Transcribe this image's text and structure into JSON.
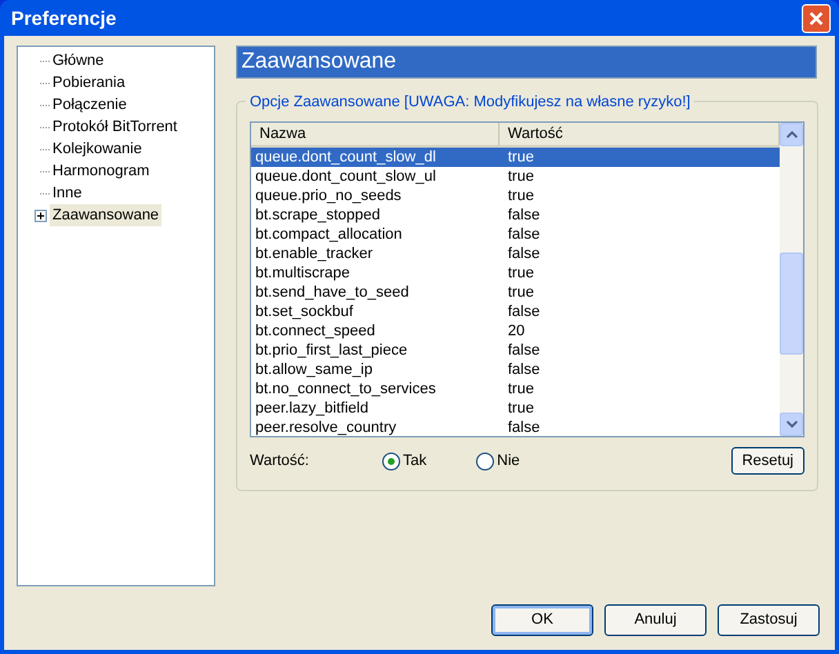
{
  "window": {
    "title": "Preferencje"
  },
  "sidebar": {
    "items": [
      {
        "label": "Główne",
        "kind": "leaf",
        "selected": false
      },
      {
        "label": "Pobierania",
        "kind": "leaf",
        "selected": false
      },
      {
        "label": "Połączenie",
        "kind": "leaf",
        "selected": false
      },
      {
        "label": "Protokół BitTorrent",
        "kind": "leaf",
        "selected": false
      },
      {
        "label": "Kolejkowanie",
        "kind": "leaf",
        "selected": false
      },
      {
        "label": "Harmonogram",
        "kind": "leaf",
        "selected": false
      },
      {
        "label": "Inne",
        "kind": "leaf",
        "selected": false
      },
      {
        "label": "Zaawansowane",
        "kind": "group",
        "expanded": false,
        "selected": true
      }
    ]
  },
  "page_title": "Zaawansowane",
  "group": {
    "legend": "Opcje Zaawansowane [UWAGA: Modyfikujesz na własne ryzyko!]",
    "table": {
      "columns": [
        "Nazwa",
        "Wartość"
      ],
      "rows": [
        {
          "name": "queue.dont_count_slow_dl",
          "value": "true",
          "selected": true
        },
        {
          "name": "queue.dont_count_slow_ul",
          "value": "true",
          "selected": false
        },
        {
          "name": "queue.prio_no_seeds",
          "value": "true",
          "selected": false
        },
        {
          "name": "bt.scrape_stopped",
          "value": "false",
          "selected": false
        },
        {
          "name": "bt.compact_allocation",
          "value": "false",
          "selected": false
        },
        {
          "name": "bt.enable_tracker",
          "value": "false",
          "selected": false
        },
        {
          "name": "bt.multiscrape",
          "value": "true",
          "selected": false
        },
        {
          "name": "bt.send_have_to_seed",
          "value": "true",
          "selected": false
        },
        {
          "name": "bt.set_sockbuf",
          "value": "false",
          "selected": false
        },
        {
          "name": "bt.connect_speed",
          "value": "20",
          "selected": false
        },
        {
          "name": "bt.prio_first_last_piece",
          "value": "false",
          "selected": false
        },
        {
          "name": "bt.allow_same_ip",
          "value": "false",
          "selected": false
        },
        {
          "name": "bt.no_connect_to_services",
          "value": "true",
          "selected": false
        },
        {
          "name": "peer.lazy_bitfield",
          "value": "true",
          "selected": false
        },
        {
          "name": "peer.resolve_country",
          "value": "false",
          "selected": false
        }
      ]
    },
    "value_label": "Wartość:",
    "options": [
      {
        "label": "Tak",
        "selected": true
      },
      {
        "label": "Nie",
        "selected": false
      }
    ],
    "reset_button": "Resetuj"
  },
  "buttons": [
    "OK",
    "Anuluj",
    "Zastosuj"
  ]
}
